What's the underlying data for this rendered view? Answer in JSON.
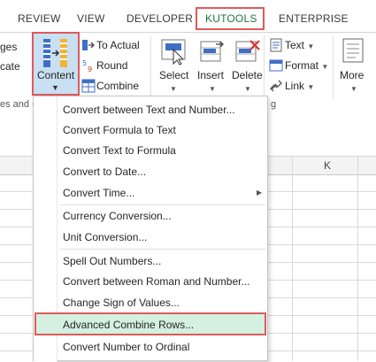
{
  "tabs": [
    "REVIEW",
    "VIEW",
    "DEVELOPER",
    "KUTOOLS",
    "ENTERPRISE"
  ],
  "left_partial": [
    "ges",
    "cate",
    "es and C"
  ],
  "ribbon": {
    "content_button": "Content",
    "to_actual": "To Actual",
    "round": "Round",
    "combine": "Combine",
    "select": "Select",
    "insert": "Insert",
    "delete": "Delete",
    "text": "Text",
    "format": "Format",
    "link": "Link",
    "more": "More",
    "group_tail": "g"
  },
  "column_header": "K",
  "menu": {
    "items": [
      "Convert between Text and Number...",
      "Convert Formula to Text",
      "Convert Text to Formula",
      "Convert to Date...",
      "Convert Time...",
      "Currency Conversion...",
      "Unit Conversion...",
      "Spell Out Numbers...",
      "Convert between Roman and Number...",
      "Change Sign of Values...",
      "Advanced Combine Rows...",
      "Convert Number to Ordinal"
    ],
    "highlighted_index": 10
  },
  "colors": {
    "kutools_tab": "#217346",
    "highlight_box": "#e05a5a",
    "highlight_fill": "#d3f0e0",
    "content_fill": "#c9dff2"
  }
}
